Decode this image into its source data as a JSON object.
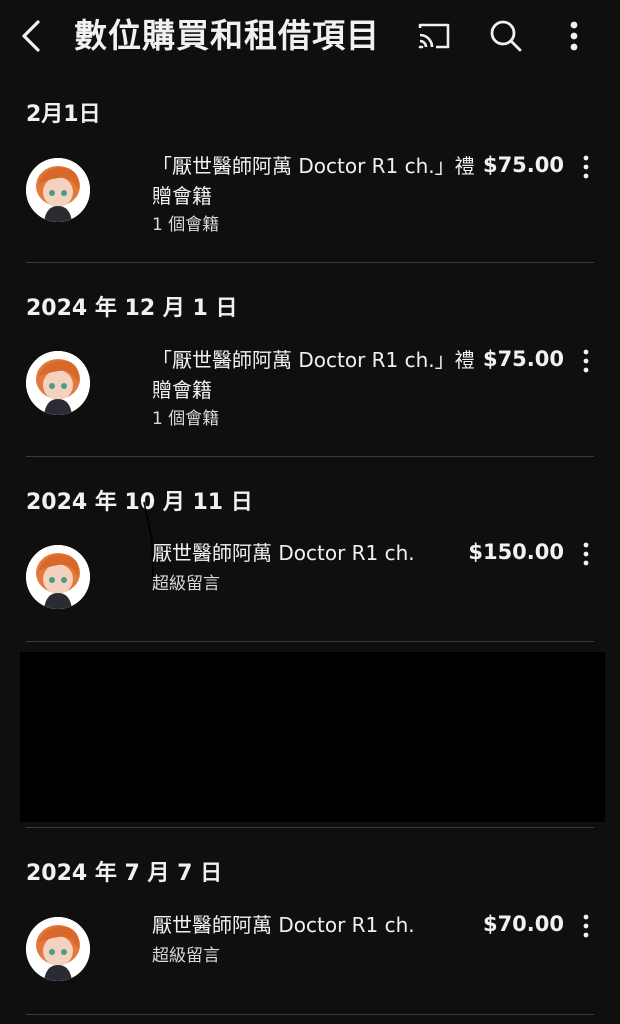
{
  "appbar": {
    "title": "數位購買和租借項目",
    "icons": [
      "back-arrow-icon",
      "cast-icon",
      "search-icon",
      "more-vert-icon"
    ]
  },
  "purchases": [
    {
      "date": "2月1日",
      "title_line1": "「厭世醫師阿萬 Doctor R1 ch.」禮",
      "title_line2": "贈會籍",
      "subtitle": "1 個會籍",
      "price": "$75.00"
    },
    {
      "date": "2024 年 12 月 1 日",
      "title_line1": "「厭世醫師阿萬 Doctor R1 ch.」禮",
      "title_line2": "贈會籍",
      "subtitle": "1 個會籍",
      "price": "$75.00"
    },
    {
      "date": "2024 年 10 月 11 日",
      "title_line1": "厭世醫師阿萬 Doctor R1 ch.",
      "title_line2": "",
      "subtitle": "超級留言",
      "price": "$150.00"
    },
    {
      "date": "2024 年 7 月 7 日",
      "title_line1": "厭世醫師阿萬 Doctor R1 ch.",
      "title_line2": "",
      "subtitle": "超級留言",
      "price": "$70.00"
    }
  ],
  "colors": {
    "background": "#0f0f0f",
    "text": "#f1f1f1",
    "divider": "#3a3a3a",
    "redaction": "#000000"
  }
}
